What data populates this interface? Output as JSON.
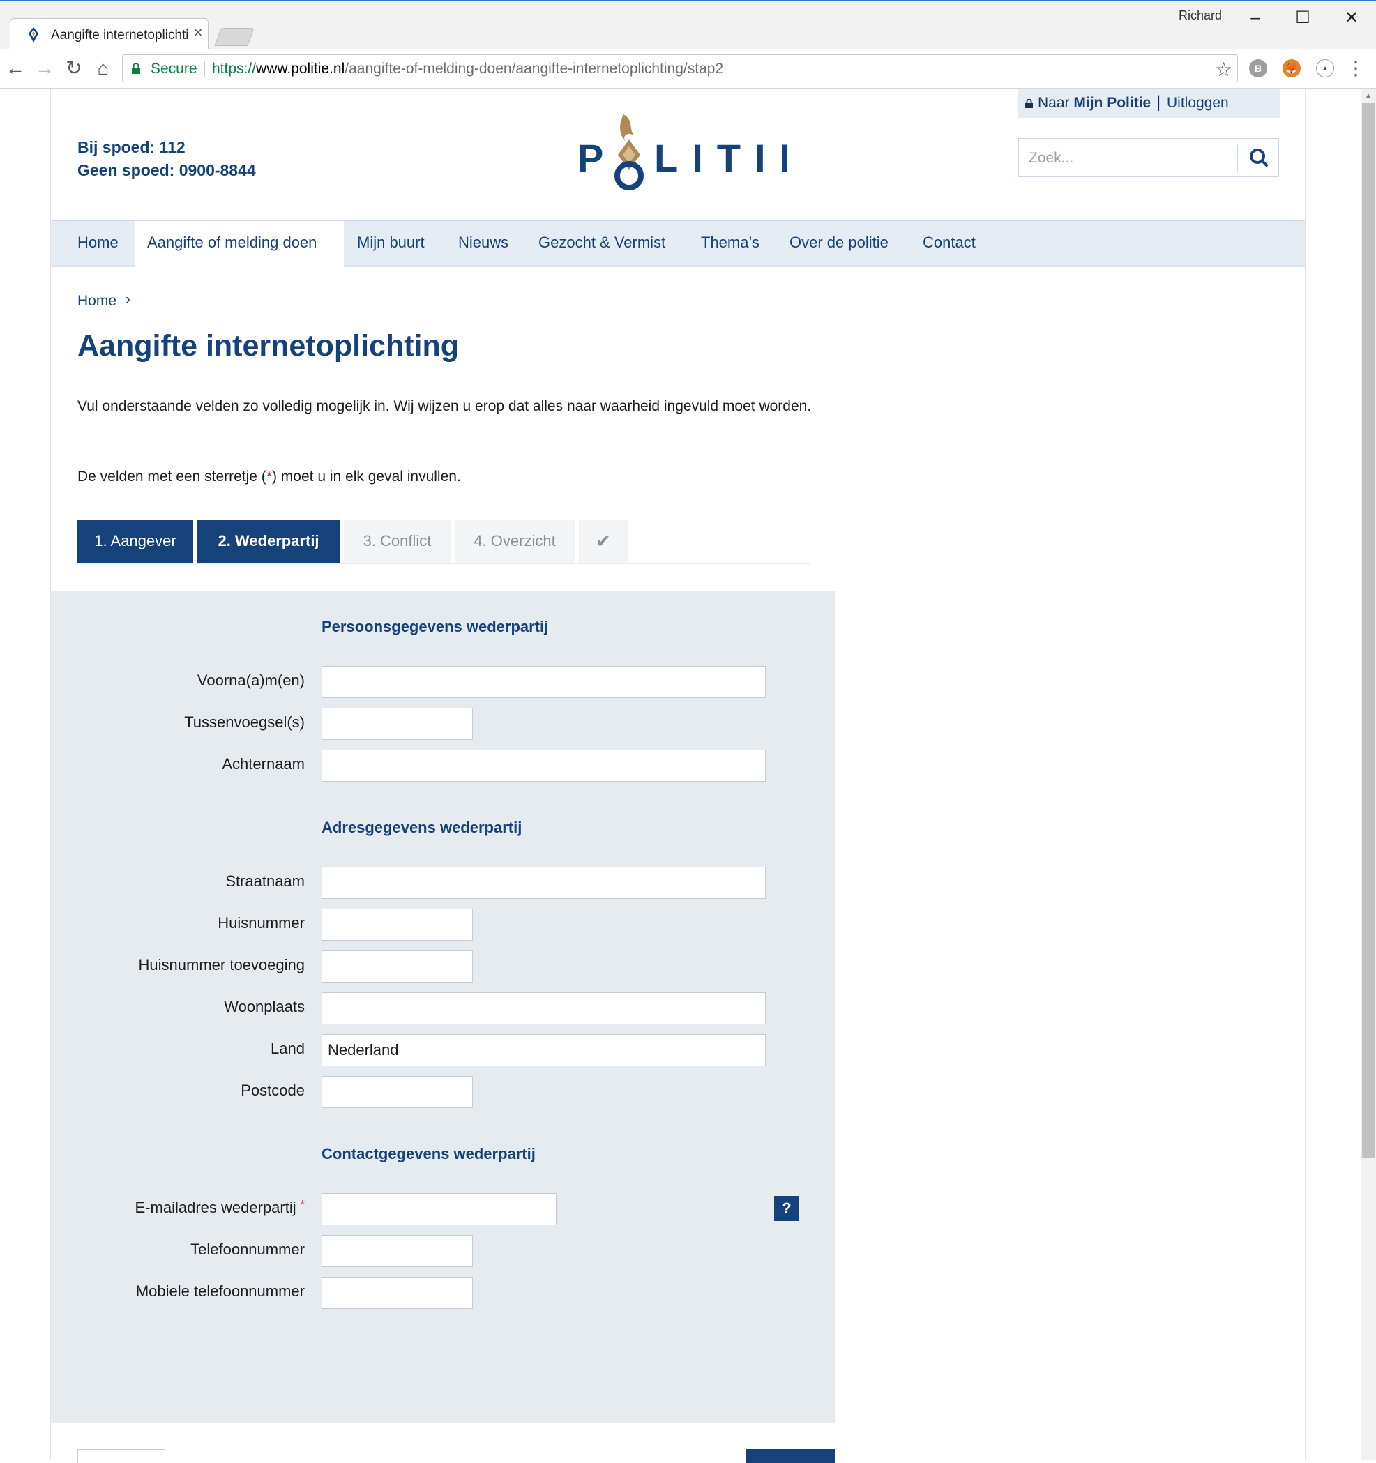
{
  "browser": {
    "tab_title": "Aangifte internetoplichting",
    "tab_close": "×",
    "profile_name": "Richard",
    "secure_label": "Secure",
    "url_scheme": "https://",
    "url_host": "www.politie.nl",
    "url_path": "/aangifte-of-melding-doen/aangifte-internetoplichting/stap2"
  },
  "account": {
    "naar_prefix": "Naar",
    "mijn_politie": "Mijn Politie",
    "separator": "|",
    "logout": "Uitloggen"
  },
  "emergency": {
    "line1": "Bij spoed: 112",
    "line2": "Geen spoed: 0900-8844"
  },
  "logo": {
    "text": "POLITIE",
    "colors": {
      "blue": "#15427a",
      "gold": "#b08a55"
    }
  },
  "search": {
    "placeholder": "Zoek..."
  },
  "nav": {
    "items": [
      "Home",
      "Aangifte of melding doen",
      "Mijn buurt",
      "Nieuws",
      "Gezocht & Vermist",
      "Thema’s",
      "Over de politie",
      "Contact"
    ],
    "active_index": 1
  },
  "breadcrumb": {
    "home": "Home",
    "sep": "›"
  },
  "page": {
    "title": "Aangifte internetoplichting",
    "intro": "Vul onderstaande velden zo volledig mogelijk in. Wij wijzen u erop dat alles naar waarheid ingevuld moet worden.",
    "required_note_before": "De velden met een sterretje (",
    "required_star": "*",
    "required_note_after": ") moet u in elk geval invullen."
  },
  "steps": [
    {
      "label": "1. Aangever",
      "state": "done"
    },
    {
      "label": "2. Wederpartij",
      "state": "current"
    },
    {
      "label": "3. Conflict",
      "state": "todo"
    },
    {
      "label": "4. Overzicht",
      "state": "todo"
    },
    {
      "label": "✔",
      "state": "todo"
    }
  ],
  "form": {
    "sections": {
      "persoon": "Persoonsgegevens wederpartij",
      "adres": "Adresgegevens wederpartij",
      "contact": "Contactgegevens wederpartij"
    },
    "labels": {
      "voornamen": "Voorna(a)m(en)",
      "tussenvoegsels": "Tussenvoegsel(s)",
      "achternaam": "Achternaam",
      "straatnaam": "Straatnaam",
      "huisnummer": "Huisnummer",
      "toevoeging": "Huisnummer toevoeging",
      "woonplaats": "Woonplaats",
      "land": "Land",
      "postcode": "Postcode",
      "email": "E-mailadres wederpartij",
      "email_required": "*",
      "telefoon": "Telefoonnummer",
      "mobiel": "Mobiele telefoonnummer"
    },
    "values": {
      "voornamen": "",
      "tussenvoegsels": "",
      "achternaam": "",
      "straatnaam": "",
      "huisnummer": "",
      "toevoeging": "",
      "woonplaats": "",
      "land": "Nederland",
      "postcode": "",
      "email": "",
      "telefoon": "",
      "mobiel": ""
    },
    "help_label": "?"
  },
  "colors": {
    "brand_blue": "#15427a",
    "panel_bg": "#e6ebf0",
    "required_red": "#d0121b",
    "secure_green": "#0b8043"
  }
}
